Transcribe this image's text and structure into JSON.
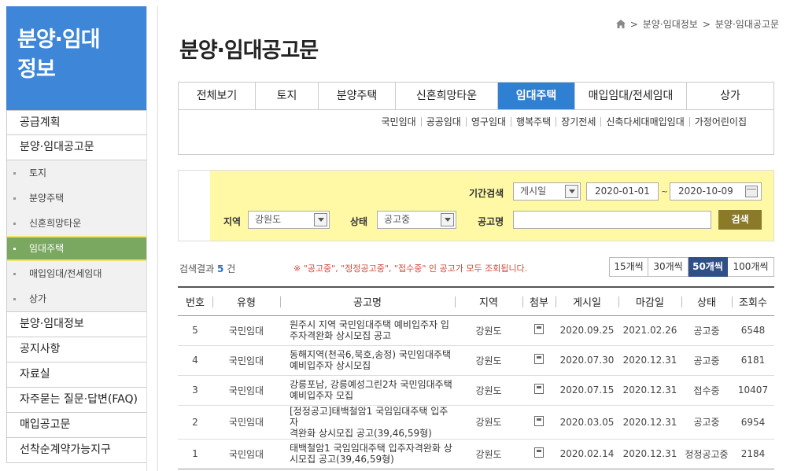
{
  "sidebar": {
    "title_line1": "분양·임대",
    "title_line2": "정보",
    "items": [
      {
        "label": "공급계획"
      },
      {
        "label": "분양·임대공고문"
      }
    ],
    "sub_items": [
      {
        "label": "토지"
      },
      {
        "label": "분양주택"
      },
      {
        "label": "신혼희망타운"
      },
      {
        "label": "임대주택",
        "active": true
      },
      {
        "label": "매입임대/전세임대"
      },
      {
        "label": "상가"
      }
    ],
    "bottom_items": [
      {
        "label": "분양·임대정보"
      },
      {
        "label": "공지사항"
      },
      {
        "label": "자료실"
      },
      {
        "label": "자주묻는 질문·답변(FAQ)"
      },
      {
        "label": "매입공고문"
      },
      {
        "label": "선착순계약가능지구"
      }
    ]
  },
  "breadcrumb": {
    "level1": "분양·임대정보",
    "level2": "분양·임대공고문",
    "sep": ">"
  },
  "page_title": "분양·임대공고문",
  "tabs": [
    {
      "label": "전체보기"
    },
    {
      "label": "토지"
    },
    {
      "label": "분양주택"
    },
    {
      "label": "신혼희망타운"
    },
    {
      "label": "임대주택",
      "active": true
    },
    {
      "label": "매입임대/전세임대"
    },
    {
      "label": "상가"
    }
  ],
  "subtabs": [
    {
      "label": "국민임대"
    },
    {
      "label": "공공임대"
    },
    {
      "label": "영구임대"
    },
    {
      "label": "행복주택"
    },
    {
      "label": "장기전세"
    },
    {
      "label": "신축다세대매입임대"
    },
    {
      "label": "가정어린이집"
    }
  ],
  "search": {
    "period_label": "기간검색",
    "period_select": "게시일",
    "date_from": "2020-01-01",
    "date_sep": "~",
    "date_to": "2020-10-09",
    "region_label": "지역",
    "region_value": "강원도",
    "status_label": "상태",
    "status_value": "공고중",
    "title_label": "공고명",
    "title_value": "",
    "button": "검색"
  },
  "results": {
    "prefix": "검색결과",
    "count": "5",
    "suffix": "건",
    "notice": "※ \"공고중\", \"정정공고중\", \"접수중\" 인 공고가 모두 조회됩니다."
  },
  "page_size": [
    {
      "label": "15개씩"
    },
    {
      "label": "30개씩"
    },
    {
      "label": "50개씩",
      "active": true
    },
    {
      "label": "100개씩"
    }
  ],
  "table": {
    "headers": [
      "번호",
      "유형",
      "공고명",
      "지역",
      "첨부",
      "게시일",
      "마감일",
      "상태",
      "조회수"
    ],
    "rows": [
      {
        "no": "5",
        "type": "국민임대",
        "title_l1": "원주시 지역 국민임대주택 예비입주자 입",
        "title_l2": "주자격완화 상시모집 공고",
        "region": "강원도",
        "posted": "2020.09.25",
        "deadline": "2021.02.26",
        "status": "공고중",
        "views": "6548"
      },
      {
        "no": "4",
        "type": "국민임대",
        "title_l1": "동해지역(천곡6,묵호,송정) 국민임대주택",
        "title_l2": "예비입주자 상시모집",
        "region": "강원도",
        "posted": "2020.07.30",
        "deadline": "2020.12.31",
        "status": "공고중",
        "views": "6181"
      },
      {
        "no": "3",
        "type": "국민임대",
        "title_l1": "강릉포남, 강릉예성그린2차 국민임대주택",
        "title_l2": "예비입주자 모집",
        "region": "강원도",
        "posted": "2020.07.15",
        "deadline": "2020.12.31",
        "status": "접수중",
        "views": "10407"
      },
      {
        "no": "2",
        "type": "국민임대",
        "title_l1": "[정정공고]태백철암1 국임임대주택 입주자",
        "title_l2": "격완화 상시모집 공고(39,46,59형)",
        "region": "강원도",
        "posted": "2020.03.05",
        "deadline": "2020.12.31",
        "status": "공고중",
        "views": "6954"
      },
      {
        "no": "1",
        "type": "국민임대",
        "title_l1": "태백철암1 국임임대주택 입주자격완화 상",
        "title_l2": "시모집 공고(39,46,59형)",
        "region": "강원도",
        "posted": "2020.02.14",
        "deadline": "2020.12.31",
        "status": "정정공고중",
        "views": "2184"
      }
    ]
  }
}
